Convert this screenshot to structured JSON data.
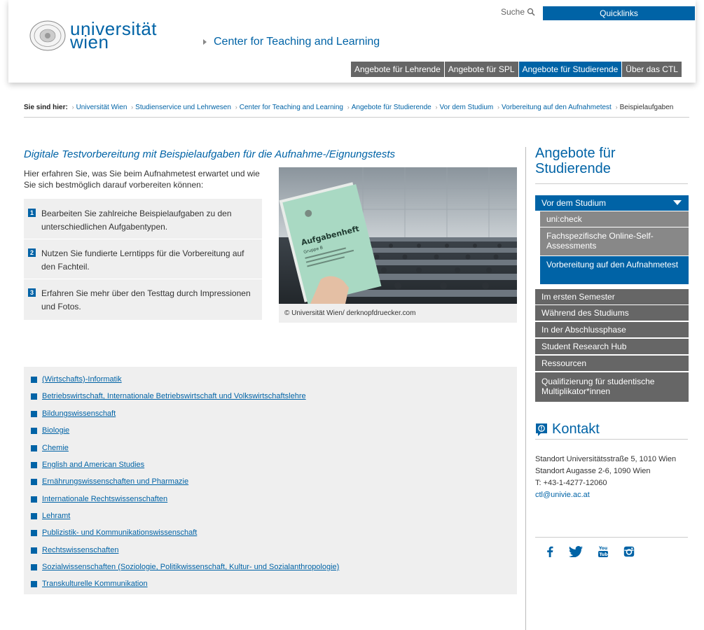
{
  "header": {
    "search_label": "Suche",
    "quicklinks_label": "Quicklinks",
    "logo_text_1": "universität",
    "logo_text_2": "wien",
    "site_title": "Center for Teaching and Learning",
    "nav": [
      {
        "label": "Angebote für Lehrende",
        "active": false
      },
      {
        "label": "Angebote für SPL",
        "active": false
      },
      {
        "label": "Angebote für Studierende",
        "active": true
      },
      {
        "label": "Über das CTL",
        "active": false
      }
    ]
  },
  "breadcrumb": {
    "prefix": "Sie sind hier:",
    "items": [
      "Universität Wien",
      "Studienservice und Lehrwesen",
      "Center for Teaching and Learning",
      "Angebote für Studierende",
      "Vor dem Studium",
      "Vorbereitung auf den Aufnahmetest"
    ],
    "current": "Beispielaufgaben"
  },
  "main": {
    "title": "Digitale Testvorbereitung mit Beispielaufgaben für die Aufnahme-/Eignungstests",
    "intro": "Hier erfahren Sie, was Sie beim Aufnahmetest erwartet und wie Sie sich bestmöglich darauf vorbereiten können:",
    "steps": [
      {
        "num": "1",
        "text": "Bearbeiten Sie zahlreiche Beispielaufgaben zu den unterschiedlichen Aufgabentypen."
      },
      {
        "num": "2",
        "text": "Nutzen Sie fundierte Lerntipps für die Vorbereitung auf den Fachteil."
      },
      {
        "num": "3",
        "text": "Erfahren Sie mehr über den Testtag durch Impressionen und Fotos."
      }
    ],
    "photo_caption": "© Universität Wien/ derknopfdruecker.com",
    "booklet_title": "Aufgabenheft",
    "booklet_sub": "Gruppe B",
    "subjects": [
      "(Wirtschafts)-Informatik",
      "Betriebswirtschaft, Internationale Betriebswirtschaft und Volkswirtschaftslehre",
      "Bildungswissenschaft",
      "Biologie",
      "Chemie",
      "English and American Studies",
      "Ernährungswissenschaften und Pharmazie",
      "Internationale Rechtswissenschaften",
      "Lehramt",
      "Publizistik- und Kommunikationswissenschaft",
      "Rechtswissenschaften",
      "Sozialwissenschaften (Soziologie, Politikwissenschaft, Kultur- und Sozialanthropologie)",
      "Transkulturelle Kommunikation"
    ]
  },
  "sidebar": {
    "title": "Angebote für Studierende",
    "menu_header": "Vor dem Studium",
    "sub_items": [
      "uni:check",
      "Fachspezifische Online-Self-Assessments",
      "Vorbereitung auf den Aufnahmetest"
    ],
    "items": [
      "Im ersten Semester",
      "Während des Studiums",
      "In der Abschlussphase",
      "Student Research Hub",
      "Ressourcen",
      "Qualifizierung für studentische Multiplikator*innen"
    ],
    "kontakt_title": "Kontakt",
    "kontakt_lines": [
      "Standort Universitätsstraße 5, 1010 Wien",
      "Standort Augasse 2-6, 1090 Wien",
      "T: +43-1-4277-12060",
      "ctl@univie.ac.at"
    ]
  },
  "colors": {
    "brand": "#0063a6",
    "nav_gray": "#666666",
    "panel": "#efefef"
  }
}
